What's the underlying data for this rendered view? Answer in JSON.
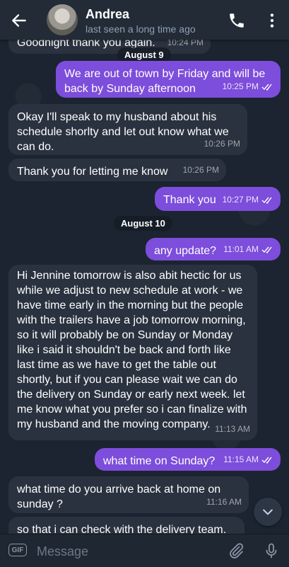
{
  "header": {
    "title": "Andrea",
    "status": "last seen a long time ago"
  },
  "messages": [
    {
      "text": "Goodnight thank you again.",
      "time": "10:24 PM",
      "dir": "in"
    },
    {
      "text": "We are out of town by Friday and will be back by Sunday afternoon",
      "time": "10:25 PM",
      "dir": "out"
    },
    {
      "text": "Okay I'll speak to my husband about his schedule shorlty and let out know what we can do.",
      "time": "10:26 PM",
      "dir": "in"
    },
    {
      "text": "Thank you for letting me know",
      "time": "10:26 PM",
      "dir": "in"
    },
    {
      "text": "Thank you",
      "time": "10:27 PM",
      "dir": "out"
    },
    {
      "text": "any update?",
      "time": "11:01 AM",
      "dir": "out"
    },
    {
      "text": "Hi Jennine tomorrow is also abit hectic for us while we adjust to new schedule at work - we have time early in the morning but the people with the trailers have a job tomorrow morning, so it will probably be on Sunday or Monday like i said it shouldn't be back and forth like last time as we have to get the table out shortly, but if you can please wait we can do the delivery on Sunday or early next week. let me know what you prefer so i can finalize with my husband and the moving company.",
      "time": "11:13 AM",
      "dir": "in"
    },
    {
      "text": "what time on Sunday?",
      "time": "11:15 AM",
      "dir": "out"
    },
    {
      "text": "what time do you arrive back at home on sunday ?",
      "time": "11:16 AM",
      "dir": "in"
    },
    {
      "text": "so that i can check with the delivery team.",
      "time": "",
      "dir": "in"
    }
  ],
  "dates": [
    "August 9",
    "August 10"
  ],
  "composer": {
    "placeholder": "Message",
    "gif_label": "GIF"
  },
  "colors": {
    "background": "#1b2430",
    "header": "#222b36",
    "incoming_bubble": "#2a323f",
    "outgoing_bubble": "#7d4ddb"
  },
  "icons": [
    "back-arrow-icon",
    "phone-icon",
    "more-vertical-icon",
    "double-check-icon",
    "chevron-down-icon",
    "gif-icon",
    "paperclip-icon",
    "microphone-icon"
  ]
}
